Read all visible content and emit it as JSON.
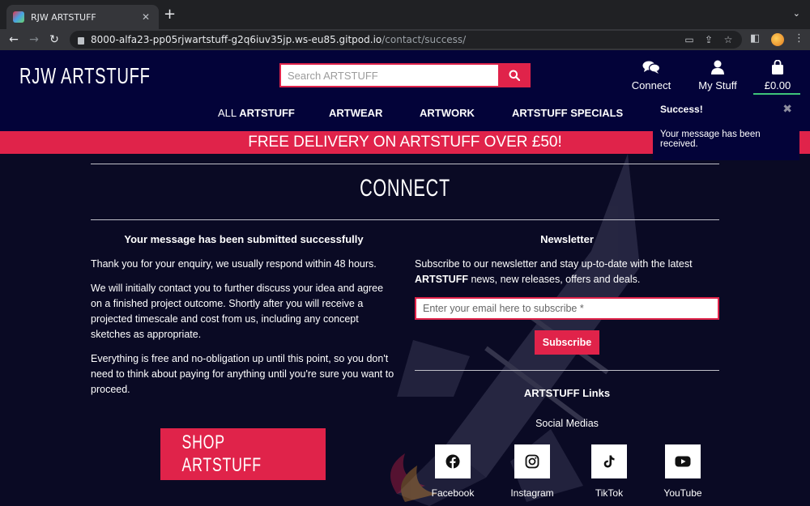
{
  "browser": {
    "tab_title": "RJW ARTSTUFF",
    "tab_close": "✕",
    "new_tab": "+",
    "url_host": "8000-alfa23-pp05rjwartstuff-g2q6iuv35jp.ws-eu85.gitpod.io",
    "url_path": "/contact/success/"
  },
  "header": {
    "logo": "RJW ARTSTUFF",
    "search_placeholder": "Search ARTSTUFF",
    "connect_label": "Connect",
    "mystuff_label": "My Stuff",
    "cart_total": "£0.00"
  },
  "nav": {
    "all_prefix": "ALL ",
    "all_label": "ARTSTUFF",
    "artwear": "ARTWEAR",
    "artwork": "ARTWORK",
    "specials": "ARTSTUFF SPECIALS"
  },
  "banner": "FREE DELIVERY ON ARTSTUFF OVER £50!",
  "toast": {
    "title": "Success!",
    "close": "✖",
    "message": "Your message has been received."
  },
  "main": {
    "title": "CONNECT",
    "left": {
      "heading": "Your message has been submitted successfully",
      "p1": "Thank you for your enquiry, we usually respond within 48 hours.",
      "p2": "We will initially contact you to further discuss your idea and agree on a finished project outcome. Shortly after you will receive a projected timescale and cost from us, including any concept sketches as appropriate.",
      "p3": "Everything is free and no-obligation up until this point, so you don't need to think about paying for anything until you're sure you want to proceed."
    },
    "shop_button": "SHOP ARTSTUFF",
    "newsletter": {
      "heading": "Newsletter",
      "text_before": "Subscribe to our newsletter and stay up-to-date with the latest ",
      "text_bold": "ARTSTUFF",
      "text_after": " news, new releases, offers and deals.",
      "email_placeholder": "Enter your email here to subscribe *",
      "subscribe_button": "Subscribe"
    },
    "links_heading": "ARTSTUFF Links",
    "social_heading": "Social Medias",
    "social": [
      {
        "label": "Facebook",
        "icon": "facebook-icon"
      },
      {
        "label": "Instagram",
        "icon": "instagram-icon"
      },
      {
        "label": "TikTok",
        "icon": "tiktok-icon"
      },
      {
        "label": "YouTube",
        "icon": "youtube-icon"
      }
    ]
  },
  "colors": {
    "header_bg": "#030339",
    "page_bg": "#0a0a24",
    "accent_red": "#e0234a",
    "cart_underline": "#3ec47a"
  }
}
